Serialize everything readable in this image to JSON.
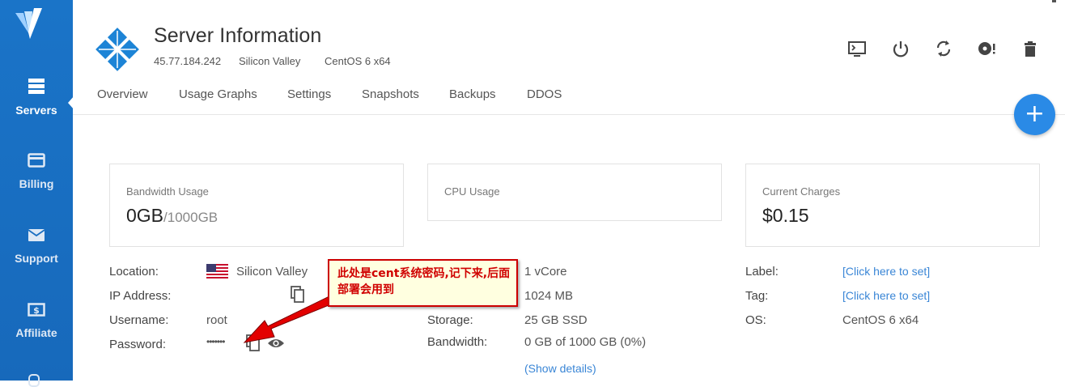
{
  "sidebar": {
    "items": [
      {
        "label": "Servers",
        "icon": "servers-icon"
      },
      {
        "label": "Billing",
        "icon": "credit-card-icon"
      },
      {
        "label": "Support",
        "icon": "envelope-icon"
      },
      {
        "label": "Affiliate",
        "icon": "dollar-icon"
      }
    ]
  },
  "header": {
    "title": "Server Information",
    "ip": "45.77.184.242",
    "location": "Silicon Valley",
    "os": "CentOS 6 x64"
  },
  "tabs": [
    "Overview",
    "Usage Graphs",
    "Settings",
    "Snapshots",
    "Backups",
    "DDOS"
  ],
  "cards": {
    "bandwidth": {
      "label": "Bandwidth Usage",
      "value": "0GB",
      "total": "/1000GB"
    },
    "cpu": {
      "label": "CPU Usage"
    },
    "charges": {
      "label": "Current Charges",
      "value": "$0.15"
    }
  },
  "details": {
    "location_label": "Location:",
    "location_value": "Silicon Valley",
    "ip_label": "IP Address:",
    "username_label": "Username:",
    "username_value": "root",
    "password_label": "Password:",
    "password_value": "•••••••",
    "cpu_value": "1 vCore",
    "ram_value": "1024 MB",
    "storage_label": "Storage:",
    "storage_value": "25 GB SSD",
    "bandwidth_label": "Bandwidth:",
    "bandwidth_value": "0 GB of 1000 GB (0%)",
    "show_details": "(Show details)",
    "label_label": "Label:",
    "label_value": "[Click here to set]",
    "tag_label": "Tag:",
    "tag_value": "[Click here to set]",
    "os_label": "OS:",
    "os_value": "CentOS 6 x64"
  },
  "annotation": {
    "text": "此处是cent系统密码,记下来,后面部署会用到",
    "color": "#cc0000",
    "background": "#ffffe0"
  },
  "colors": {
    "sidebar": "#1a74c8",
    "accent": "#2a8ae6",
    "link": "#3a86d6"
  }
}
